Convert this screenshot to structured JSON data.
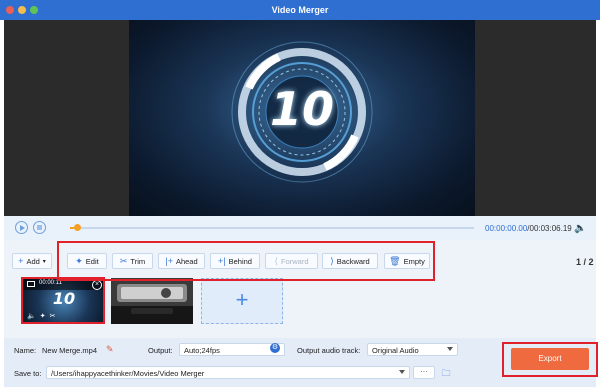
{
  "window": {
    "title": "Video Merger"
  },
  "preview": {
    "countdown": "10"
  },
  "playback": {
    "progress": 0.01,
    "current_time": "00:00:00.00",
    "total_time": "/00:03:06.19"
  },
  "toolbar": {
    "add_label": "Add",
    "edit_label": "Edit",
    "trim_label": "Trim",
    "ahead_label": "Ahead",
    "behind_label": "Behind",
    "forward_label": "Forward",
    "backward_label": "Backward",
    "empty_label": "Empty",
    "page_indicator": "1 / 2"
  },
  "clips": [
    {
      "duration": "00:00:11",
      "number": "10"
    },
    {
      "duration": ""
    }
  ],
  "output": {
    "name_label": "Name:",
    "name_value": "New Merge.mp4",
    "output_label": "Output:",
    "output_value": "Auto;24fps",
    "audio_label": "Output audio track:",
    "audio_value": "Original Audio",
    "save_label": "Save to:",
    "save_path": "/Users/ihappyacethinker/Movies/Video Merger",
    "more_label": "···",
    "export_label": "Export"
  },
  "colors": {
    "titlebar": "#2f6fd1",
    "accent": "#3a78d6",
    "export": "#ef6b3f",
    "progress": "#f5a023",
    "highlight": "#e0202a"
  }
}
